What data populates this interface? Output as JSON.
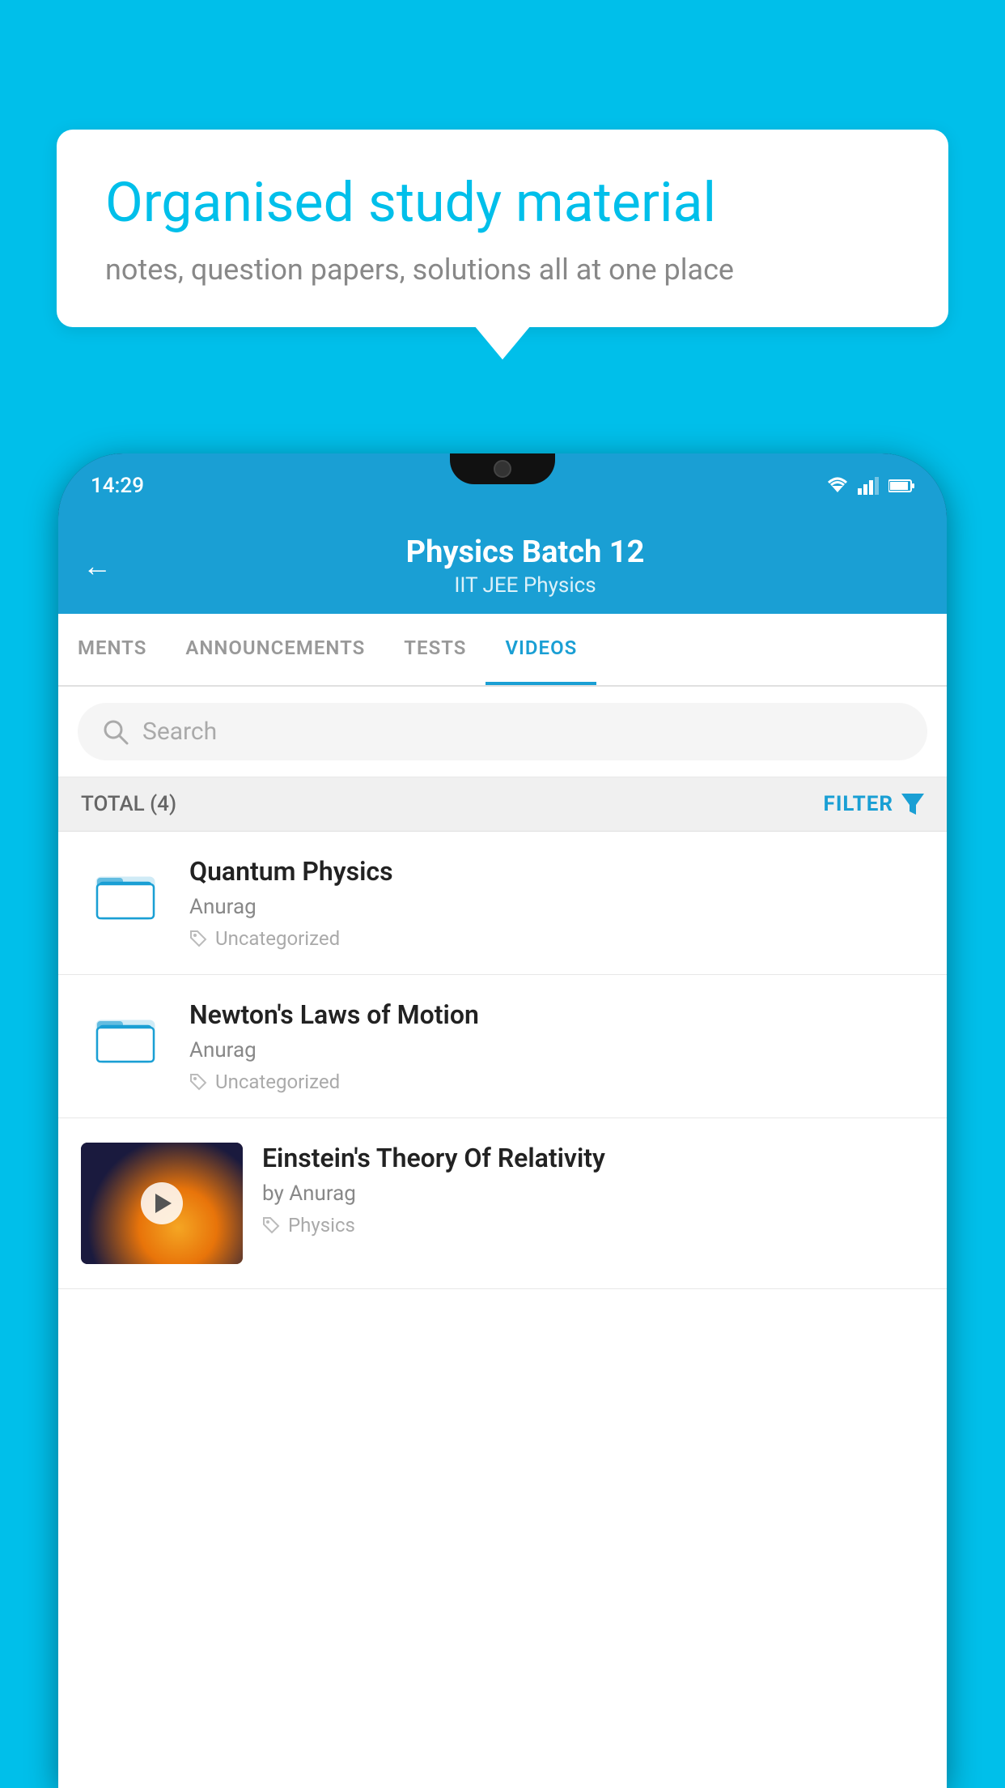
{
  "background_color": "#00BFEA",
  "speech_bubble": {
    "title": "Organised study material",
    "subtitle": "notes, question papers, solutions all at one place"
  },
  "phone": {
    "status_bar": {
      "time": "14:29"
    },
    "app_header": {
      "title": "Physics Batch 12",
      "subtitle_tags": "IIT JEE   Physics",
      "back_label": "←"
    },
    "tabs": [
      {
        "label": "MENTS",
        "active": false
      },
      {
        "label": "ANNOUNCEMENTS",
        "active": false
      },
      {
        "label": "TESTS",
        "active": false
      },
      {
        "label": "VIDEOS",
        "active": true
      }
    ],
    "search": {
      "placeholder": "Search"
    },
    "filter_row": {
      "total_label": "TOTAL (4)",
      "filter_label": "FILTER"
    },
    "videos": [
      {
        "id": 1,
        "title": "Quantum Physics",
        "author": "Anurag",
        "tag": "Uncategorized",
        "type": "folder"
      },
      {
        "id": 2,
        "title": "Newton's Laws of Motion",
        "author": "Anurag",
        "tag": "Uncategorized",
        "type": "folder"
      },
      {
        "id": 3,
        "title": "Einstein's Theory Of Relativity",
        "author": "by Anurag",
        "tag": "Physics",
        "type": "video"
      }
    ]
  }
}
